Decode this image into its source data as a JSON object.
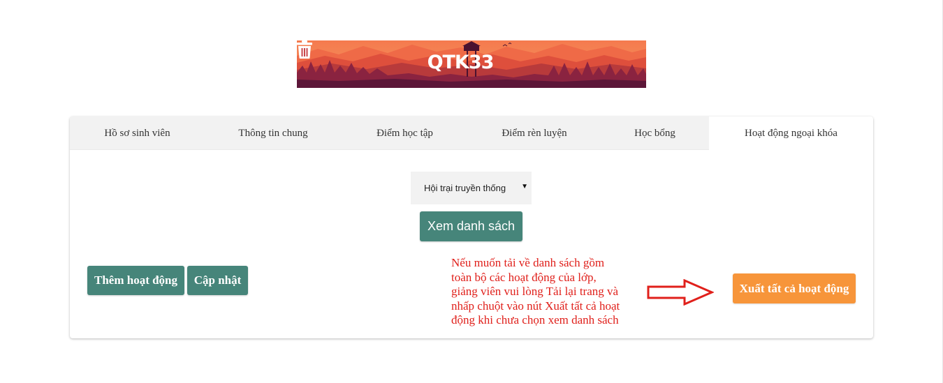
{
  "banner": {
    "class_name": "QTK33",
    "delete_icon": "trash-icon",
    "colors": {
      "sky": "#f06b45",
      "mountains": "#d2503e",
      "forest": "#7a1f3a"
    }
  },
  "tabs": [
    {
      "label": "Hồ sơ sinh viên",
      "active": false
    },
    {
      "label": "Thông tin chung",
      "active": false
    },
    {
      "label": "Điểm học tập",
      "active": false
    },
    {
      "label": "Điểm rèn luyện",
      "active": false
    },
    {
      "label": "Học bổng",
      "active": false
    },
    {
      "label": "Hoạt động ngoại khóa",
      "active": true
    }
  ],
  "activity_select": {
    "selected": "Hội trại truyền thống",
    "icon": "caret-down-icon"
  },
  "buttons": {
    "view_list": "Xem danh sách",
    "add_activity": "Thêm hoạt động",
    "update": "Cập nhật",
    "export_all": "Xuất tất cả hoạt động"
  },
  "note": {
    "lines": [
      "Nếu muốn tải về danh sách gồm",
      "toàn bộ các hoạt động của lớp,",
      "giảng viên vui lòng Tải lại trang và",
      "nhấp chuột vào nút Xuất tất cả hoạt",
      "động khi chưa chọn xem danh sách"
    ],
    "color": "#e0201b",
    "arrow_icon": "right-arrow-icon"
  },
  "colors": {
    "teal_button": "#46857a",
    "orange_button": "#f7953a",
    "tab_bar": "#f2f2f2"
  }
}
